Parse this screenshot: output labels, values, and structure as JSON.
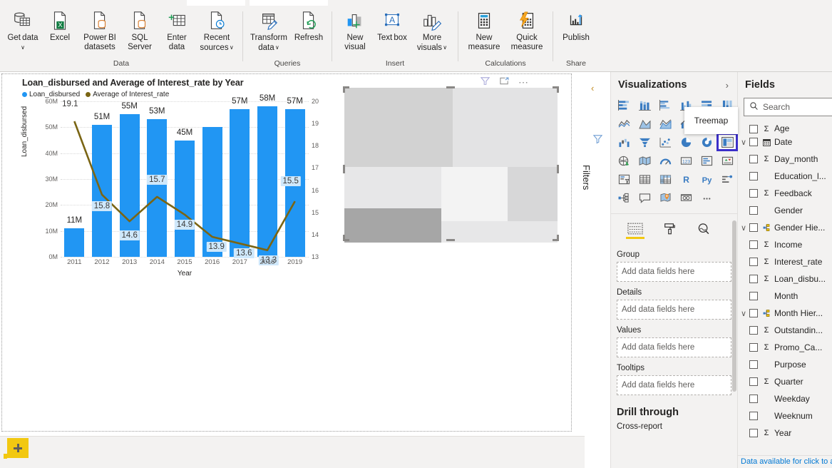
{
  "ribbon": {
    "groups": [
      {
        "label": "Data",
        "items": [
          {
            "label": "Get data",
            "icon": "get-data-icon",
            "caret": true
          },
          {
            "label": "Excel",
            "icon": "excel-icon",
            "caret": false
          },
          {
            "label": "Power BI datasets",
            "icon": "powerbi-datasets-icon",
            "caret": false
          },
          {
            "label": "SQL Server",
            "icon": "sql-server-icon",
            "caret": false
          },
          {
            "label": "Enter data",
            "icon": "enter-data-icon",
            "caret": false
          },
          {
            "label": "Recent sources",
            "icon": "recent-sources-icon",
            "caret": true
          }
        ]
      },
      {
        "label": "Queries",
        "items": [
          {
            "label": "Transform data",
            "icon": "transform-data-icon",
            "caret": true
          },
          {
            "label": "Refresh",
            "icon": "refresh-icon",
            "caret": false
          }
        ]
      },
      {
        "label": "Insert",
        "items": [
          {
            "label": "New visual",
            "icon": "new-visual-icon",
            "caret": false
          },
          {
            "label": "Text box",
            "icon": "text-box-icon",
            "caret": false
          },
          {
            "label": "More visuals",
            "icon": "more-visuals-icon",
            "caret": true
          }
        ]
      },
      {
        "label": "Calculations",
        "items": [
          {
            "label": "New measure",
            "icon": "new-measure-icon",
            "caret": false
          },
          {
            "label": "Quick measure",
            "icon": "quick-measure-icon",
            "caret": false
          }
        ]
      },
      {
        "label": "Share",
        "items": [
          {
            "label": "Publish",
            "icon": "publish-icon",
            "caret": false
          }
        ]
      }
    ]
  },
  "chart_data": {
    "type": "bar",
    "title": "Loan_disbursed and Average of Interest_rate by Year",
    "xlabel": "Year",
    "ylabel": "Loan_disbursed",
    "categories": [
      "2011",
      "2012",
      "2013",
      "2014",
      "2015",
      "2016",
      "2017",
      "2018",
      "2019"
    ],
    "legend": [
      {
        "name": "Loan_disbursed",
        "color": "#2196f3",
        "marker": "circle"
      },
      {
        "name": "Average of Interest_rate",
        "color": "#7a6514",
        "marker": "circle"
      }
    ],
    "legend_position": "top-left",
    "grid": true,
    "series": [
      {
        "name": "Loan_disbursed",
        "type": "bar",
        "axis": "left",
        "color": "#2196f3",
        "values": [
          11,
          51,
          55,
          53,
          45,
          50,
          57,
          58,
          57
        ],
        "labels": [
          "11M",
          "51M",
          "55M",
          "53M",
          "45M",
          "",
          "57M",
          "58M",
          "57M"
        ]
      },
      {
        "name": "Average of Interest_rate",
        "type": "line",
        "axis": "right",
        "color": "#7a6514",
        "values": [
          19.1,
          15.8,
          14.6,
          15.7,
          14.9,
          13.9,
          13.6,
          13.3,
          15.5
        ],
        "labels": [
          "19.1",
          "15.8",
          "14.6",
          "15.7",
          "14.9",
          "13.9",
          "13.6",
          "13.3",
          "15.5"
        ]
      }
    ],
    "y_left_ticks": [
      "0M",
      "10M",
      "20M",
      "30M",
      "40M",
      "50M",
      "60M"
    ],
    "y_left_lim": [
      0,
      60
    ],
    "y_right_ticks": [
      "13",
      "14",
      "15",
      "16",
      "17",
      "18",
      "19",
      "20"
    ],
    "y_right_lim": [
      13,
      20
    ]
  },
  "visual_header": {
    "filter_icon": "filter-icon",
    "focus_icon": "focus-mode-icon",
    "more_icon": "more-options-icon"
  },
  "filters_rail": {
    "collapse_label": "‹",
    "icon": "filter-icon",
    "label": "Filters"
  },
  "visualizations": {
    "title": "Visualizations",
    "chevron": "›",
    "tooltip": "Treemap",
    "selected_icon": "treemap-icon",
    "icons": [
      "stacked-bar-chart-icon",
      "stacked-column-chart-icon",
      "clustered-bar-chart-icon",
      "clustered-column-chart-icon",
      "hundred-percent-stacked-bar-icon",
      "hundred-percent-stacked-column-icon",
      "line-chart-icon",
      "area-chart-icon",
      "stacked-area-chart-icon",
      "line-and-stacked-column-icon",
      "line-and-clustered-column-icon",
      "ribbon-chart-icon",
      "waterfall-chart-icon",
      "funnel-icon",
      "scatter-chart-icon",
      "pie-chart-icon",
      "donut-chart-icon",
      "treemap-icon",
      "map-icon",
      "filled-map-icon",
      "gauge-icon",
      "card-icon",
      "multi-row-card-icon",
      "kpi-icon",
      "slicer-icon",
      "table-icon",
      "matrix-icon",
      "r-script-visual-icon",
      "python-visual-icon",
      "key-influencers-icon",
      "decomposition-tree-icon",
      "qna-icon",
      "arcgis-maps-icon",
      "paginated-report-icon",
      "more-options-icon"
    ],
    "tabs": [
      {
        "name": "fields-tab",
        "active": true
      },
      {
        "name": "format-tab",
        "active": false
      },
      {
        "name": "analytics-tab",
        "active": false
      }
    ],
    "wells": [
      {
        "label": "Group",
        "placeholder": "Add data fields here"
      },
      {
        "label": "Details",
        "placeholder": "Add data fields here"
      },
      {
        "label": "Values",
        "placeholder": "Add data fields here"
      },
      {
        "label": "Tooltips",
        "placeholder": "Add data fields here"
      }
    ],
    "drill_through_title": "Drill through",
    "drill_through_sub": "Cross-report"
  },
  "fields": {
    "title": "Fields",
    "search_placeholder": "Search",
    "search_icon": "search-icon",
    "items": [
      {
        "label": "Age",
        "type": "Σ",
        "expandable": false,
        "partial": true
      },
      {
        "label": "Date",
        "type": "calendar",
        "expandable": true,
        "partial": false
      },
      {
        "label": "Day_month",
        "type": "Σ",
        "expandable": false,
        "partial": false
      },
      {
        "label": "Education_l...",
        "type": "",
        "expandable": false,
        "partial": false
      },
      {
        "label": "Feedback",
        "type": "Σ",
        "expandable": false,
        "partial": false
      },
      {
        "label": "Gender",
        "type": "",
        "expandable": false,
        "partial": false
      },
      {
        "label": "Gender Hie...",
        "type": "hierarchy",
        "expandable": true,
        "partial": false
      },
      {
        "label": "Income",
        "type": "Σ",
        "expandable": false,
        "partial": false
      },
      {
        "label": "Interest_rate",
        "type": "Σ",
        "expandable": false,
        "partial": false
      },
      {
        "label": "Loan_disbu...",
        "type": "Σ",
        "expandable": false,
        "partial": false
      },
      {
        "label": "Month",
        "type": "",
        "expandable": false,
        "partial": false
      },
      {
        "label": "Month Hier...",
        "type": "hierarchy",
        "expandable": true,
        "partial": false
      },
      {
        "label": "Outstandin...",
        "type": "Σ",
        "expandable": false,
        "partial": false
      },
      {
        "label": "Promo_Ca...",
        "type": "Σ",
        "expandable": false,
        "partial": false
      },
      {
        "label": "Purpose",
        "type": "",
        "expandable": false,
        "partial": false
      },
      {
        "label": "Quarter",
        "type": "Σ",
        "expandable": false,
        "partial": false
      },
      {
        "label": "Weekday",
        "type": "",
        "expandable": false,
        "partial": false
      },
      {
        "label": "Weeknum",
        "type": "",
        "expandable": false,
        "partial": false
      },
      {
        "label": "Year",
        "type": "Σ",
        "expandable": false,
        "partial": false
      }
    ],
    "footer_text": "Data available for click to add"
  },
  "page_tabs": {
    "add_page_label": "+"
  },
  "colors": {
    "bar": "#2196f3",
    "line": "#7a6514",
    "accent": "#f2c811",
    "selection": "#3b2fc9",
    "pane_bg": "#f3f2f1"
  }
}
